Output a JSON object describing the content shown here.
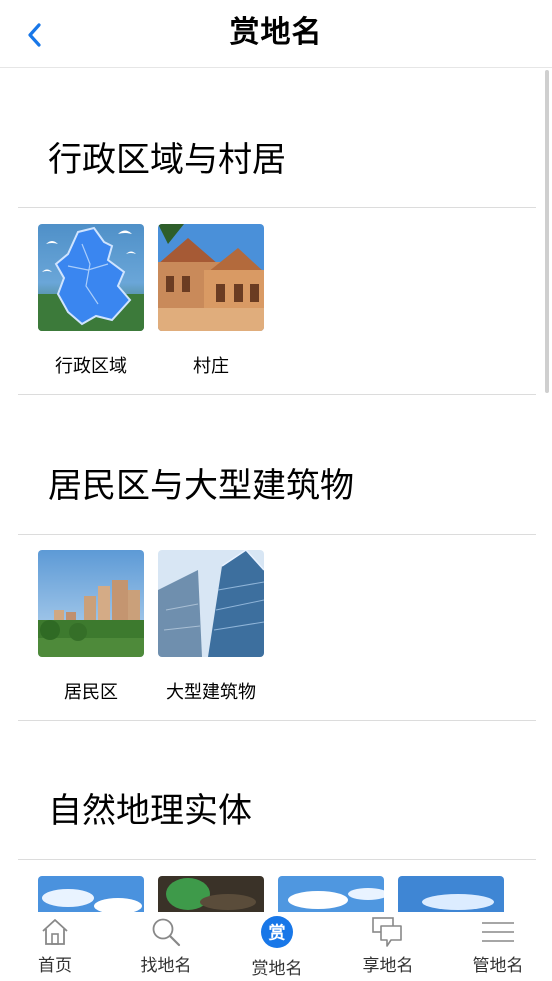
{
  "header": {
    "title": "赏地名"
  },
  "sections": [
    {
      "title": "行政区域与村居",
      "items": [
        {
          "label": "行政区域"
        },
        {
          "label": "村庄"
        }
      ]
    },
    {
      "title": "居民区与大型建筑物",
      "items": [
        {
          "label": "居民区"
        },
        {
          "label": "大型建筑物"
        }
      ]
    },
    {
      "title": "自然地理实体"
    }
  ],
  "tabs": [
    {
      "label": "首页",
      "icon": "home-icon"
    },
    {
      "label": "找地名",
      "icon": "search-icon"
    },
    {
      "label": "赏地名",
      "icon": "appreciate-icon",
      "badge": "赏"
    },
    {
      "label": "享地名",
      "icon": "share-chat-icon"
    },
    {
      "label": "管地名",
      "icon": "menu-icon"
    }
  ],
  "colors": {
    "accent": "#1877e8",
    "text": "#000000",
    "divider": "#dcdcdc"
  }
}
